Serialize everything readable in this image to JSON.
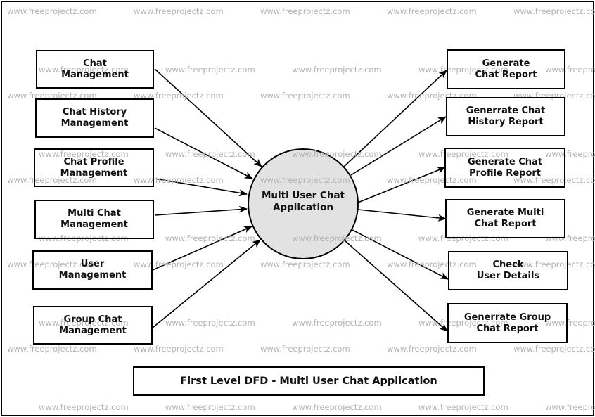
{
  "diagram": {
    "title": "First Level DFD - Multi User Chat Application",
    "central_process": "Multi User Chat\nApplication",
    "inputs": [
      "Chat\nManagement",
      "Chat History\nManagement",
      "Chat Profile\nManagement",
      "Multi Chat\nManagement",
      "User\nManagement",
      "Group Chat\nManagement"
    ],
    "outputs": [
      "Generate\nChat Report",
      "Generrate Chat\nHistory Report",
      "Generate Chat\nProfile Report",
      "Generate Multi\nChat Report",
      "Check\nUser Details",
      "Generrate Group\nChat Report"
    ],
    "watermark": "www.freeprojectz.com",
    "colors": {
      "process_fill": "#e2e2e2",
      "stroke": "#000000",
      "watermark": "#b3b3b3"
    }
  }
}
